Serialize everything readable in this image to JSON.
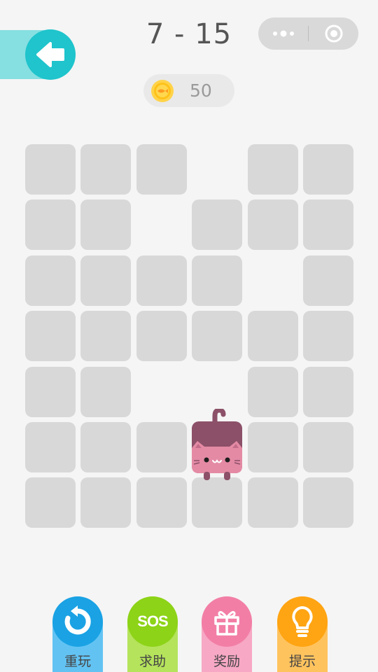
{
  "header": {
    "level": "7 - 15",
    "back_icon": "arrow-left-icon",
    "menu_icon": "more-dots-icon",
    "close_icon": "target-circle-icon"
  },
  "coins": {
    "value": "50",
    "icon": "fish-coin-icon"
  },
  "board": {
    "columns": 6,
    "rows": 7,
    "empty_cells": [
      [
        0,
        3
      ],
      [
        1,
        2
      ],
      [
        2,
        4
      ],
      [
        4,
        2
      ],
      [
        4,
        3
      ]
    ],
    "cat_position": [
      5,
      3
    ]
  },
  "actions": [
    {
      "label": "重玩",
      "icon": "replay-icon",
      "color": "#1aa2e4",
      "stem": "#62c3f3"
    },
    {
      "label": "求助",
      "icon": "sos-icon",
      "text": "SOS",
      "color": "#8dd317",
      "stem": "#b5e35c"
    },
    {
      "label": "奖励",
      "icon": "gift-icon",
      "color": "#f27ea6",
      "stem": "#f7a8c4"
    },
    {
      "label": "提示",
      "icon": "lightbulb-icon",
      "color": "#ffa412",
      "stem": "#ffc35e"
    }
  ],
  "colors": {
    "background": "#f5f5f5",
    "tile": "#d8d8d8",
    "back_button": "#1fc4cc",
    "cat_body": "#8c5068",
    "cat_face": "#e48aa5"
  }
}
